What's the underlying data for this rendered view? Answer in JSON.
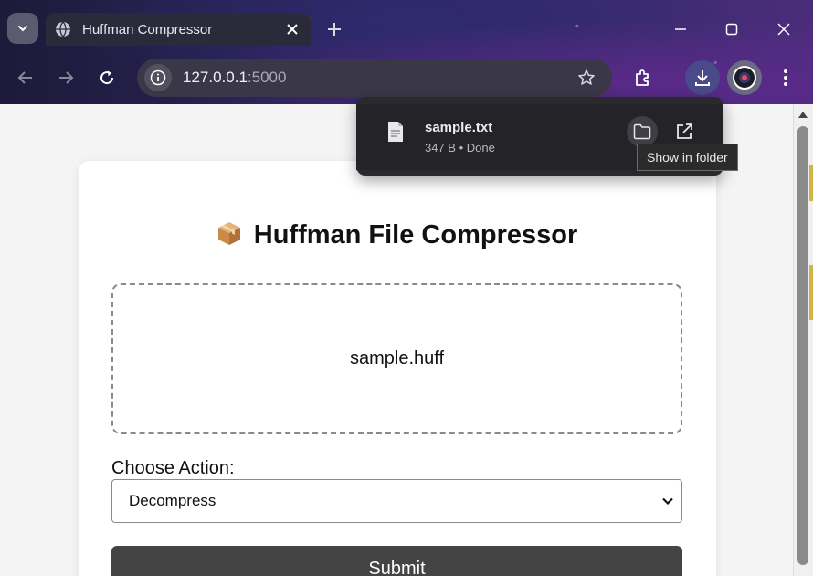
{
  "browser": {
    "tab": {
      "title": "Huffman Compressor"
    },
    "address": {
      "host": "127.0.0.1",
      "port": ":5000"
    }
  },
  "downloads": {
    "file_name": "sample.txt",
    "status": "347 B • Done",
    "tooltip": "Show in folder"
  },
  "page": {
    "title": "Huffman File Compressor",
    "title_emoji": "📦",
    "dropzone_file": "sample.huff",
    "action_label": "Choose Action:",
    "action_selected": "Decompress",
    "submit_label": "Submit"
  }
}
